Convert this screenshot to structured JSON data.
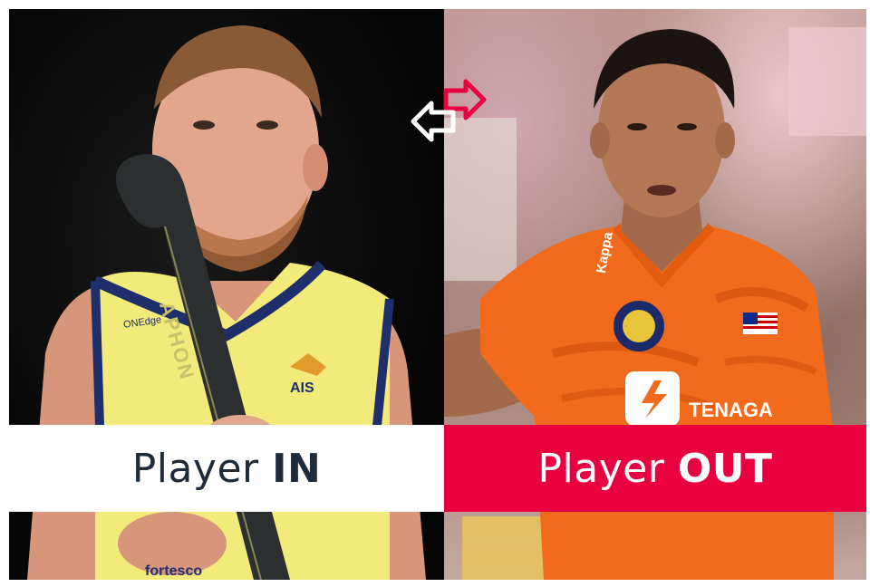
{
  "banner": {
    "in_prefix": "Player ",
    "in_strong": "IN",
    "out_prefix": "Player ",
    "out_strong": "OUT"
  },
  "left_player": {
    "jersey_text_ais": "AIS",
    "jersey_text_onedge": "ONEdge",
    "stick_text": "APHON",
    "shorts_text": "fortesco"
  },
  "right_player": {
    "jersey_text_kappa": "Kappa",
    "jersey_text_sponsor": "TENAGA"
  },
  "colors": {
    "in_banner": "#ffffff",
    "out_banner": "#e8003f",
    "in_text": "#1d2b3a",
    "out_text": "#ffffff",
    "arrow_in": "#ffffff",
    "arrow_out": "#e8003f",
    "jersey_left": "#f2ea7a",
    "jersey_right": "#f26a1b"
  },
  "icons": {
    "swap_in_arrow": "arrow-left-icon",
    "swap_out_arrow": "arrow-right-icon"
  }
}
